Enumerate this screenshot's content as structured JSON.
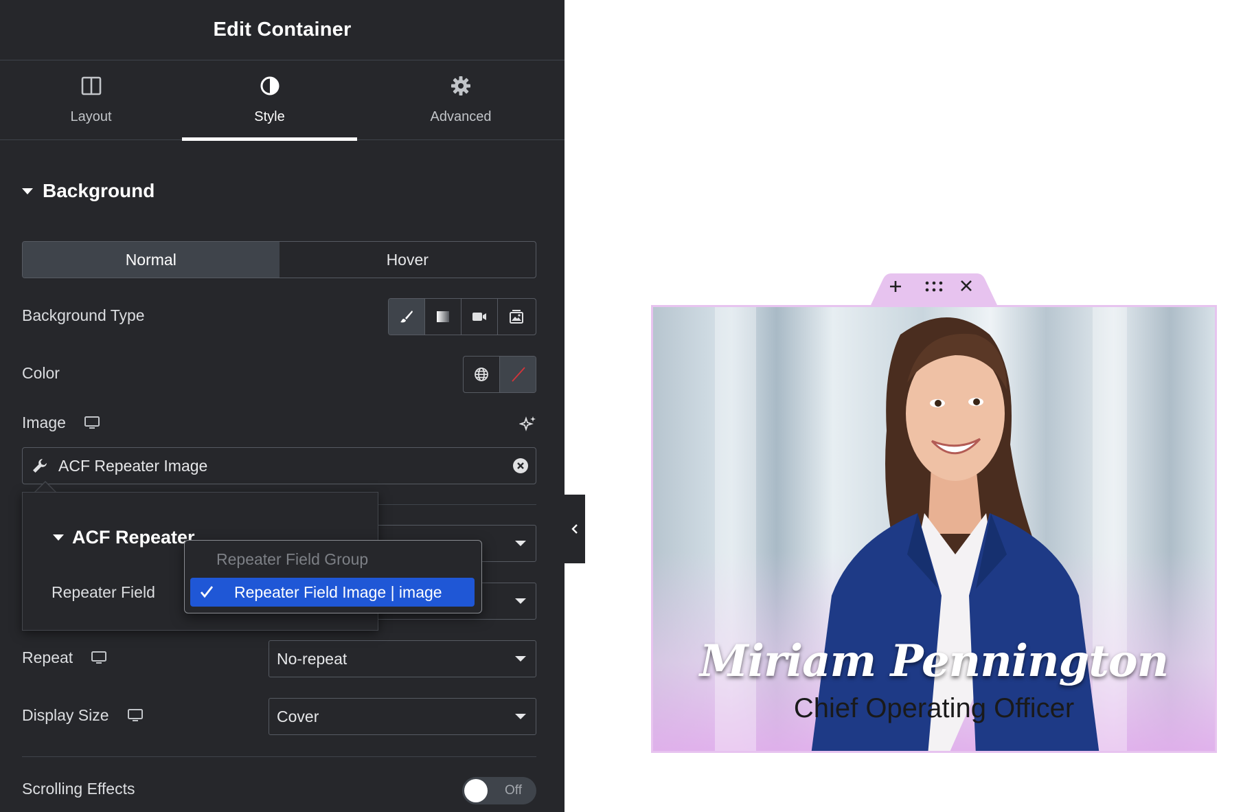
{
  "header": {
    "title": "Edit Container"
  },
  "tabs": [
    {
      "label": "Layout",
      "icon": "layout-columns-icon"
    },
    {
      "label": "Style",
      "icon": "half-circle-icon",
      "active": true
    },
    {
      "label": "Advanced",
      "icon": "gear-icon"
    }
  ],
  "section": {
    "title": "Background"
  },
  "state_switch": {
    "normal": "Normal",
    "hover": "Hover",
    "active": "Normal"
  },
  "background_type": {
    "label": "Background Type",
    "options": [
      "brush-icon",
      "gradient-icon",
      "video-icon",
      "slideshow-icon"
    ],
    "selected": "brush-icon"
  },
  "color": {
    "label": "Color"
  },
  "image": {
    "label": "Image",
    "dynamic_value": "ACF Repeater Image"
  },
  "popup": {
    "title": "ACF Repeater",
    "field_label": "Repeater Field",
    "dropdown": {
      "group_label": "Repeater Field Group",
      "selected_option": "Repeater Field Image | image"
    }
  },
  "repeat": {
    "label": "Repeat",
    "value": "No-repeat"
  },
  "display_size": {
    "label": "Display Size",
    "value": "Cover"
  },
  "scrolling_effects": {
    "label": "Scrolling Effects",
    "toggle_label": "Off",
    "enabled": false
  },
  "preview": {
    "name": "Miriam Pennington",
    "role": "Chief Operating Officer",
    "accent_color": "#e7c3ef"
  },
  "colors": {
    "panel_bg": "#26272b",
    "border": "#575b63",
    "selected_blue": "#1f57d6"
  }
}
